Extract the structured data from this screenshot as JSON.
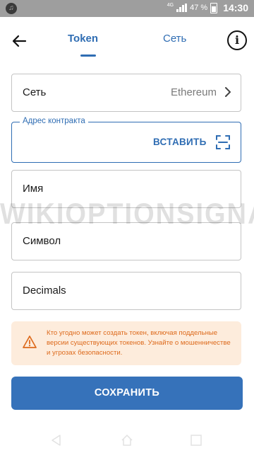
{
  "status_bar": {
    "network": "4G",
    "battery": "47 %",
    "time": "14:30",
    "app_icon": "music-note-icon"
  },
  "header": {
    "tab_token": "Token",
    "tab_network": "Сеть",
    "active_tab": "Token"
  },
  "form": {
    "network": {
      "label": "Сеть",
      "value": "Ethereum"
    },
    "contract_address": {
      "label": "Адрес контракта",
      "value": "",
      "paste_label": "ВСТАВИТЬ"
    },
    "name": {
      "placeholder": "Имя"
    },
    "symbol": {
      "placeholder": "Символ"
    },
    "decimals": {
      "placeholder": "Decimals"
    }
  },
  "warning": {
    "text": "Кто угодно может создать токен, включая поддельные версии существующих токенов. Узнайте о мошенничестве и угрозах безопасности."
  },
  "save_button": {
    "label": "СОХРАНИТЬ"
  },
  "watermark": "WIKIOPTIONSIGNALS.COM",
  "colors": {
    "accent": "#2f6db3",
    "button": "#3672ba",
    "warning_bg": "#fdecdc",
    "warning_text": "#dd6a1c",
    "status_bar": "#9e9e9e"
  }
}
